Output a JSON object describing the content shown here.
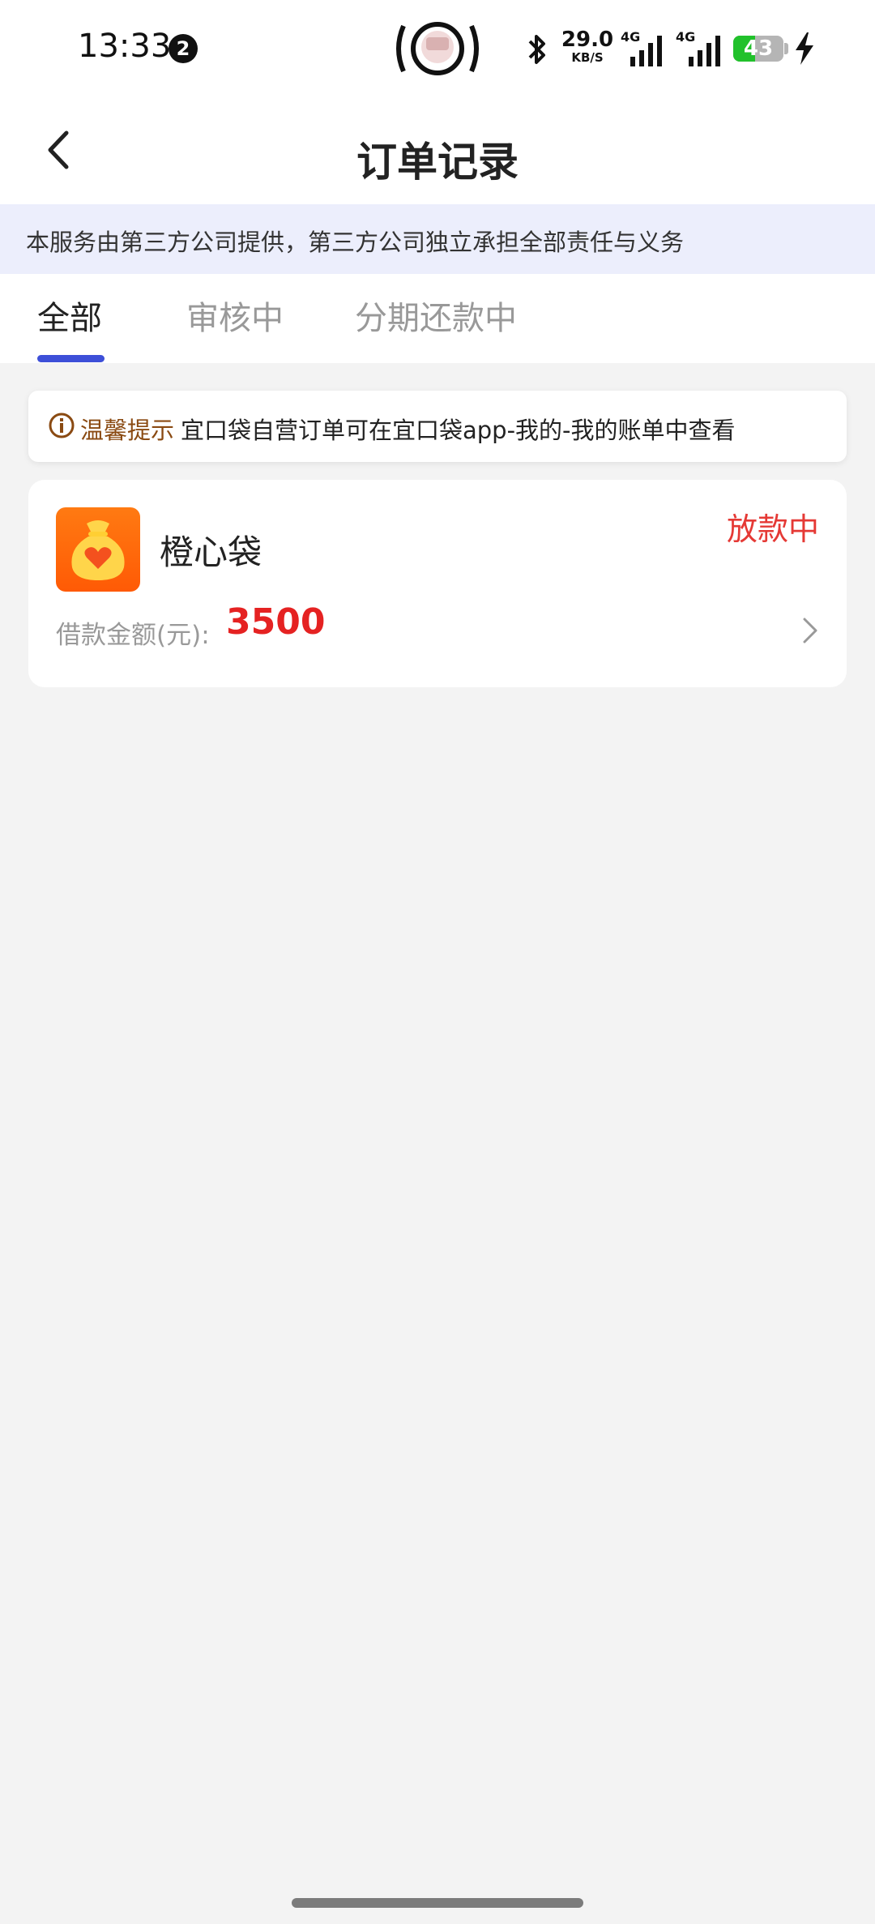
{
  "status_bar": {
    "time": "13:33",
    "notification_count": "2",
    "net_speed_value": "29.0",
    "net_speed_unit": "KB/S",
    "sim1_label": "4G",
    "sim2_label": "4G",
    "battery_level": "43",
    "battery_fraction": 0.43,
    "battery_color": "#21c12b",
    "icons": [
      "bluetooth-icon",
      "signal-icon",
      "charging-icon",
      "hotspot-icon"
    ]
  },
  "header": {
    "title": "订单记录",
    "back_icon": "chevron-left-icon"
  },
  "notice": {
    "text": "本服务由第三方公司提供，第三方公司独立承担全部责任与义务"
  },
  "tabs": {
    "items": [
      {
        "label": "全部",
        "active": true
      },
      {
        "label": "审核中",
        "active": false
      },
      {
        "label": "分期还款中",
        "active": false
      }
    ],
    "accent_color": "#3d4fd8"
  },
  "tip": {
    "icon": "info-icon",
    "label": "温馨提示",
    "text": "宜口袋自营订单可在宜口袋app-我的-我的账单中查看"
  },
  "orders": [
    {
      "product_icon": "money-bag-heart-icon",
      "product_name": "橙心袋",
      "status": "放款中",
      "amount_label": "借款金额(元):",
      "amount": "3500",
      "status_color": "#e53935"
    }
  ]
}
